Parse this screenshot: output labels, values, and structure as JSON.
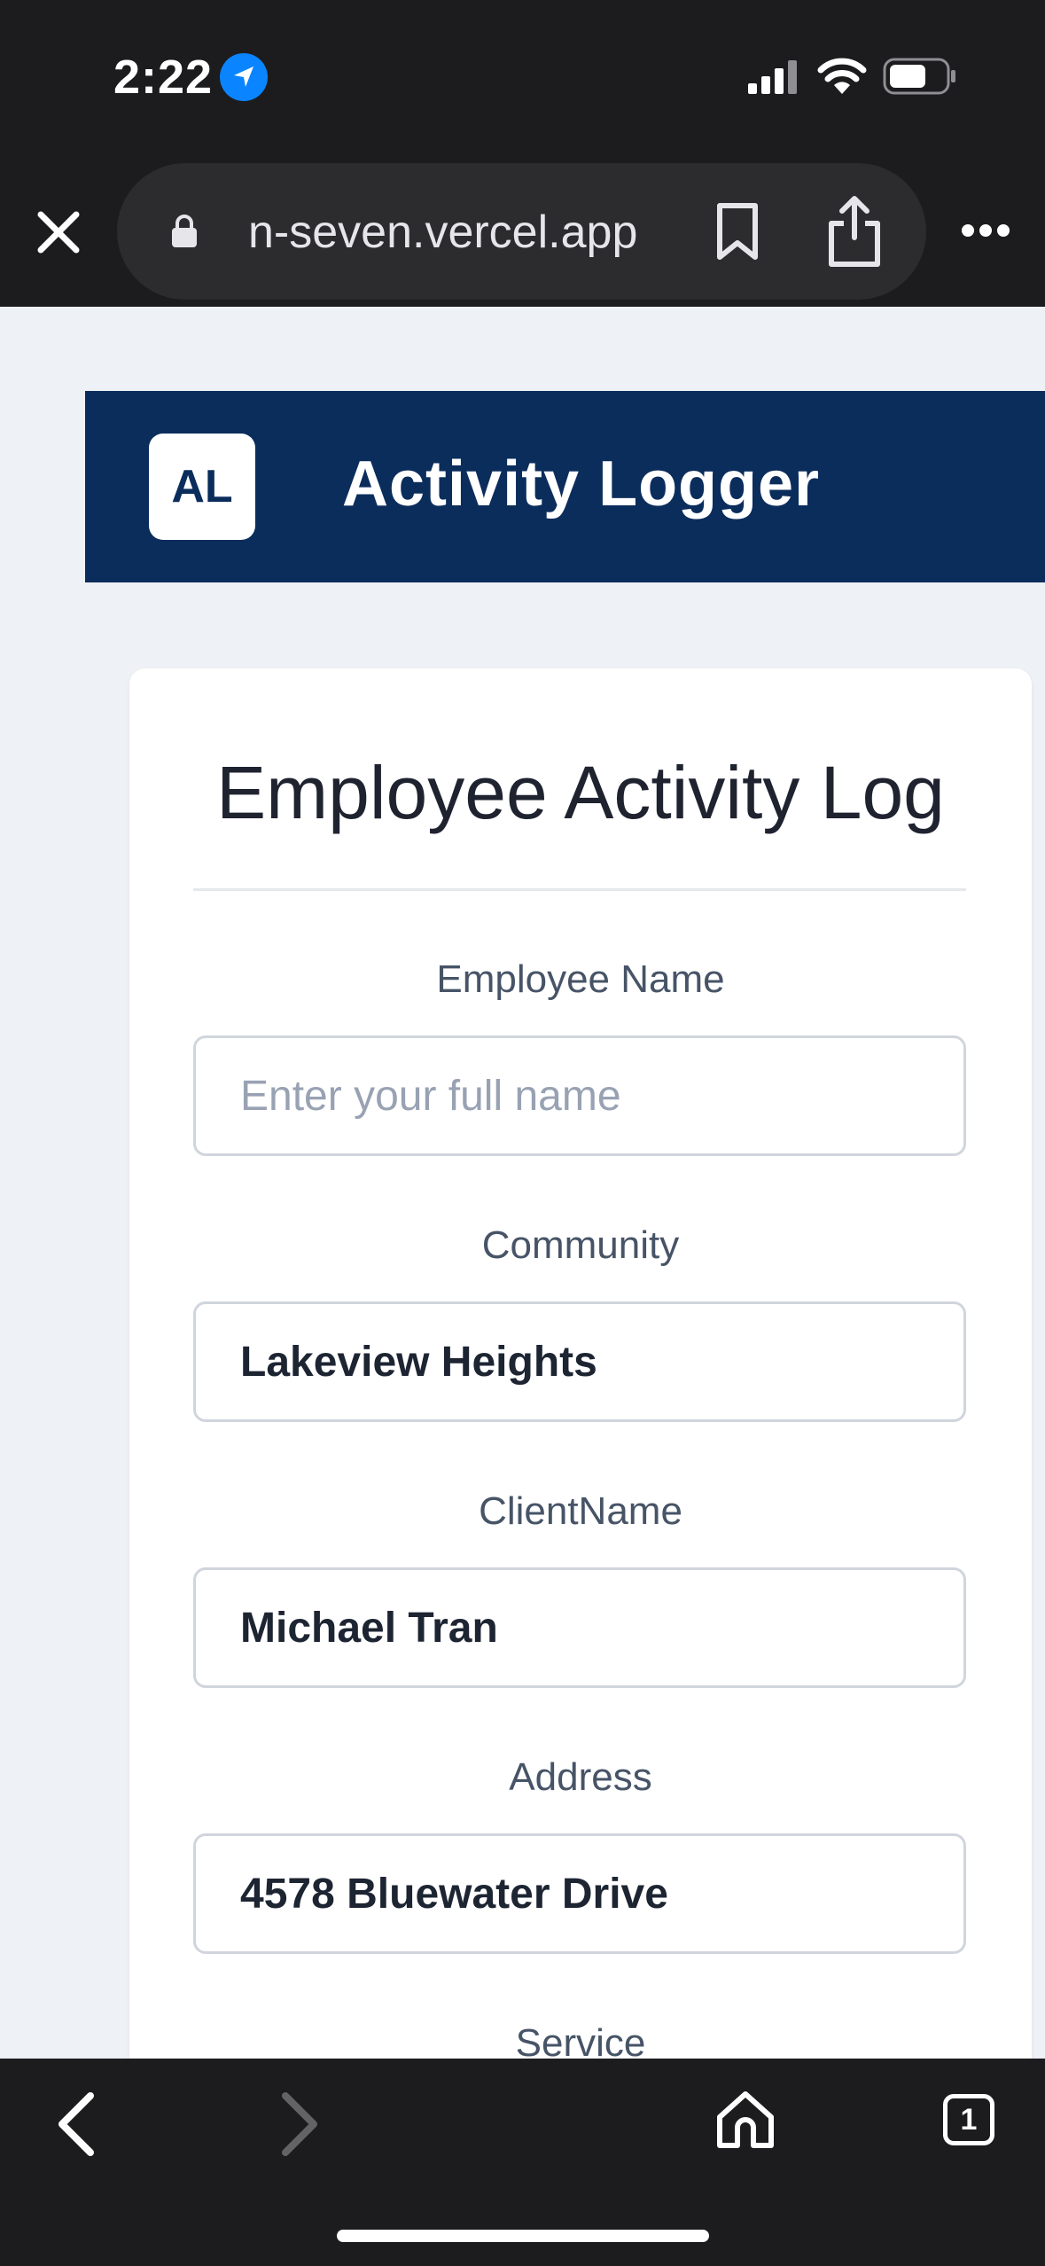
{
  "status_bar": {
    "time": "2:22",
    "icons": [
      "location-arrow-icon",
      "cellular-signal-icon",
      "wifi-icon",
      "battery-icon"
    ]
  },
  "browser": {
    "url": "n-seven.vercel.app",
    "icons": [
      "close-icon",
      "lock-icon",
      "bookmark-icon",
      "share-icon",
      "more-icon"
    ]
  },
  "app": {
    "logo": "AL",
    "title": "Activity Logger",
    "header_color": "#0b2d5c"
  },
  "form": {
    "title": "Employee Activity Log",
    "fields": [
      {
        "label": "Employee Name",
        "value": "",
        "placeholder": "Enter your full name"
      },
      {
        "label": "Community",
        "value": "Lakeview Heights"
      },
      {
        "label": "ClientName",
        "value": "Michael Tran"
      },
      {
        "label": "Address",
        "value": "4578 Bluewater Drive"
      },
      {
        "label": "Service"
      }
    ]
  },
  "bottom_bar": {
    "tab_count": "1",
    "icons": [
      "back-icon",
      "forward-icon",
      "home-icon",
      "tabs-icon"
    ]
  }
}
